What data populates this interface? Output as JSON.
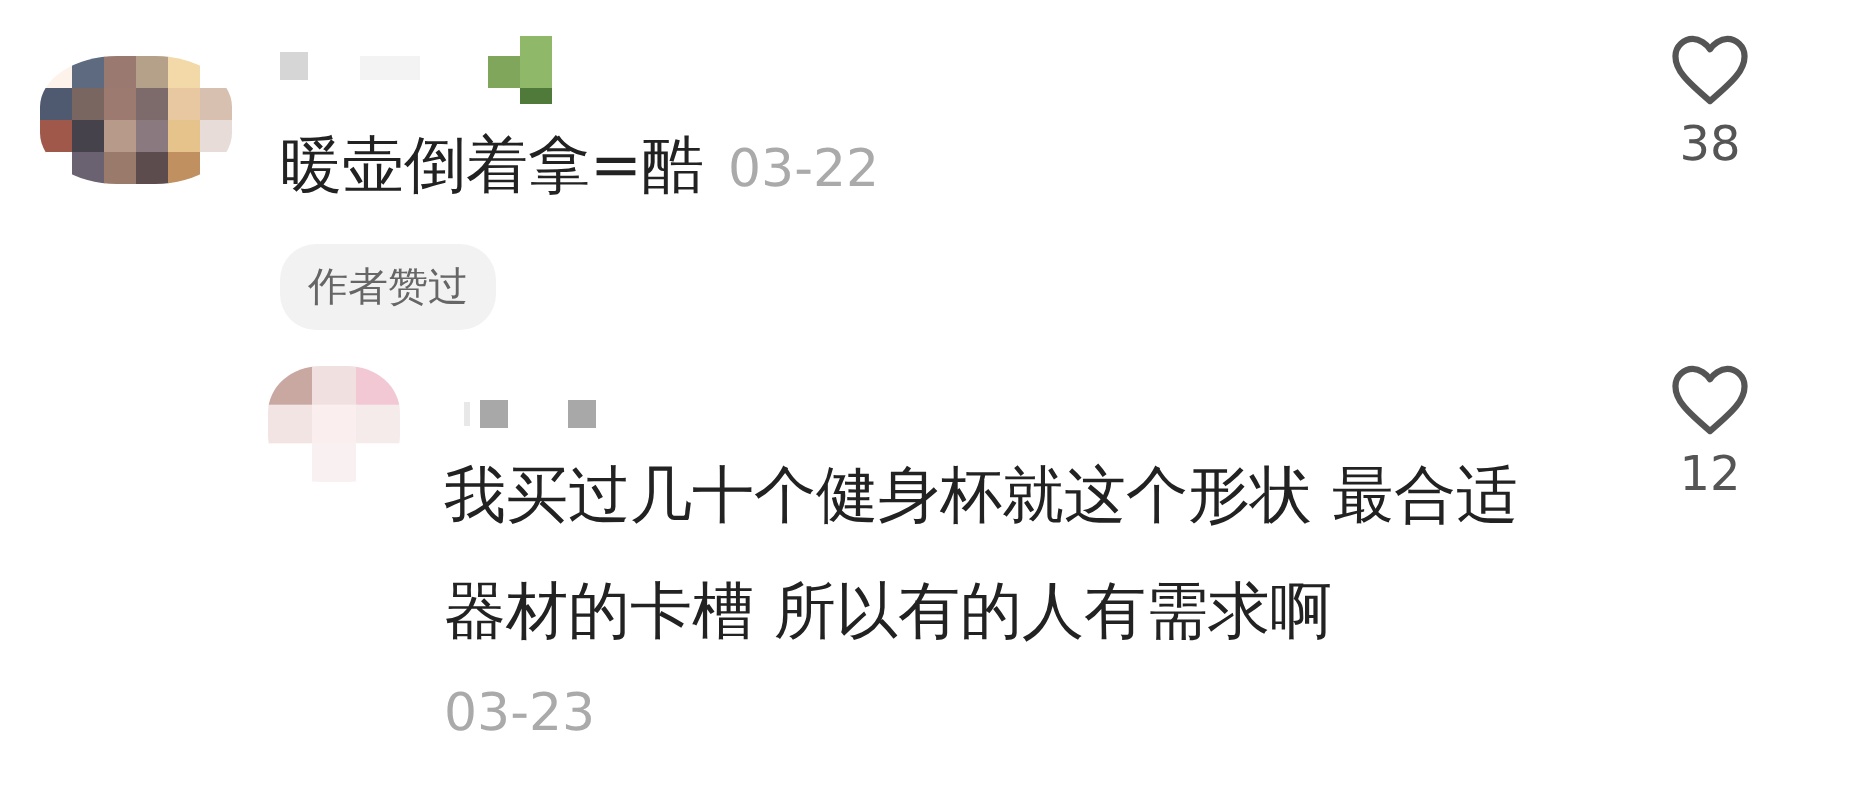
{
  "comments": [
    {
      "kind": "top",
      "text": "暖壶倒着拿=酷",
      "date": "03-22",
      "badge": "作者赞过",
      "like_count": "38",
      "liked": false
    },
    {
      "kind": "reply",
      "text": "我买过几十个健身杯就这个形状 最合适器材的卡槽 所以有的人有需求啊",
      "date": "03-23",
      "like_count": "12",
      "liked": false
    }
  ]
}
